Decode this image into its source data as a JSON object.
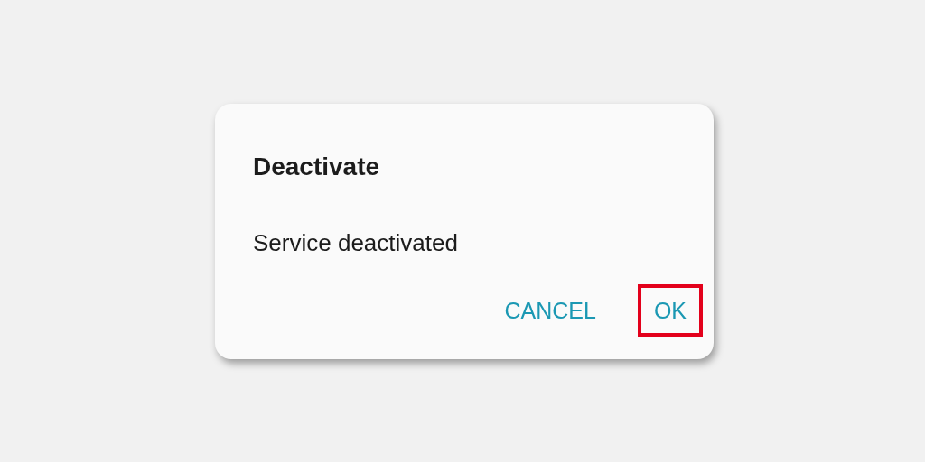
{
  "dialog": {
    "title": "Deactivate",
    "message": "Service deactivated",
    "buttons": [
      {
        "label": "CANCEL",
        "highlighted": false
      },
      {
        "label": "OK",
        "highlighted": true
      }
    ]
  }
}
